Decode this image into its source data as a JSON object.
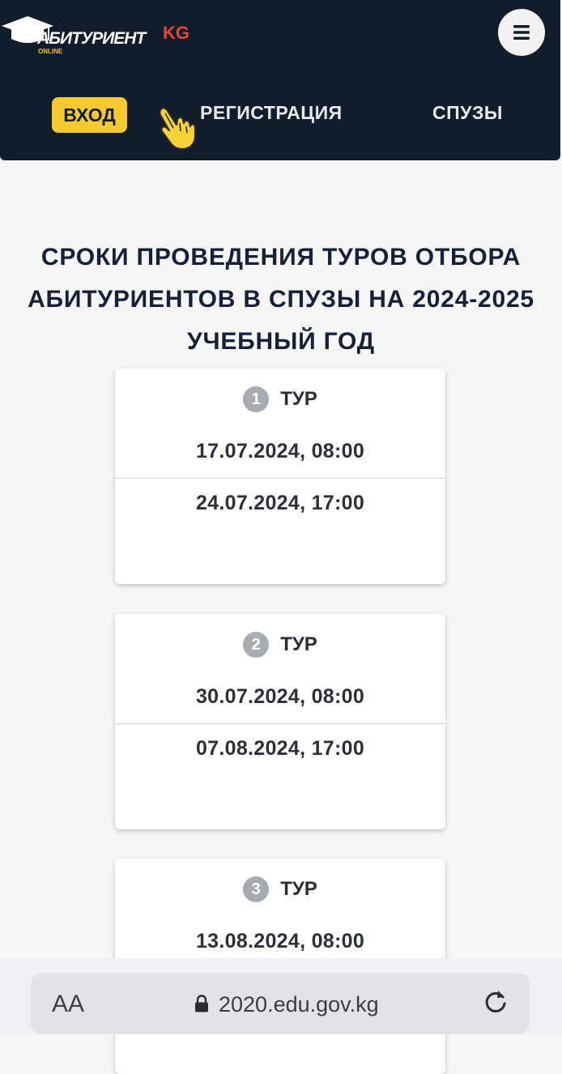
{
  "header": {
    "logo_text": "АБИТУРИЕНТ",
    "logo_sub": "ONLINE",
    "lang": "KG",
    "nav": {
      "login": "ВХОД",
      "register": "РЕГИСТРАЦИЯ",
      "spuzy": "СПУЗЫ"
    },
    "menu_icon": "hamburger-icon",
    "colors": {
      "background": "#111d2b",
      "accent": "#f6ca2f",
      "lang": "#e0483c"
    }
  },
  "main": {
    "title": "СРОКИ ПРОВЕДЕНИЯ ТУРОВ ОТБОРА АБИТУРИЕНТОВ В СПУЗЫ НА 2024-2025 УЧЕБНЫЙ ГОД",
    "rounds": [
      {
        "number": "1",
        "label": "ТУР",
        "start": "17.07.2024, 08:00",
        "end": "24.07.2024, 17:00"
      },
      {
        "number": "2",
        "label": "ТУР",
        "start": "30.07.2024, 08:00",
        "end": "07.08.2024, 17:00"
      },
      {
        "number": "3",
        "label": "ТУР",
        "start": "13.08.2024, 08:00"
      }
    ]
  },
  "browser": {
    "text_size": "AA",
    "url": "2020.edu.gov.kg",
    "icons": [
      "lock-icon",
      "reload-icon"
    ]
  }
}
